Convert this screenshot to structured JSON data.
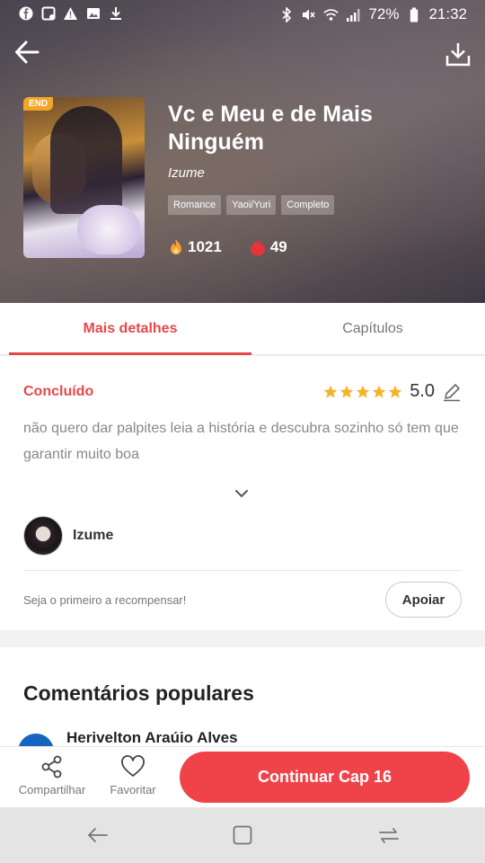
{
  "statusbar": {
    "battery": "72%",
    "time": "21:32",
    "left_icons": [
      "facebook-icon",
      "notification-icon",
      "warning-icon",
      "image-icon",
      "download-icon"
    ],
    "right_icons": [
      "bluetooth-icon",
      "mute-icon",
      "wifi-icon",
      "signal-icon",
      "battery-icon"
    ]
  },
  "book": {
    "badge": "END",
    "title": "Vc e Meu e de Mais Ninguém",
    "author": "Izume",
    "tags": [
      "Romance",
      "Yaoi/Yuri",
      "Completo"
    ],
    "views": "1021",
    "likes": "49"
  },
  "tabs": {
    "details": "Mais detalhes",
    "chapters": "Capítulos"
  },
  "details": {
    "status": "Concluído",
    "stars": 5,
    "rating": "5.0",
    "description": "não quero dar palpites leia a história e descubra sozinho só tem que garantir muito boa",
    "author_name": "Izume",
    "reward_text": "Seja o primeiro a recompensar!",
    "support_label": "Apoiar"
  },
  "comments": {
    "title": "Comentários populares",
    "first_commenter": "Herivelton Araúio Alves"
  },
  "bottombar": {
    "share_label": "Compartilhar",
    "favorite_label": "Favoritar",
    "continue_label": "Continuar Cap 16"
  },
  "colors": {
    "accent": "#e8474a",
    "button": "#f04349",
    "star": "#f5b428",
    "badge": "#f3a52b"
  }
}
